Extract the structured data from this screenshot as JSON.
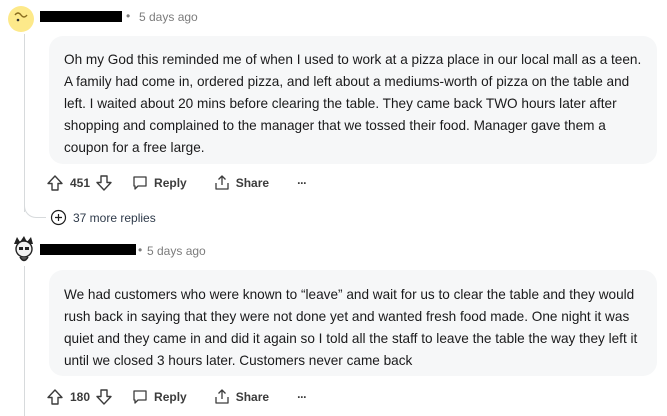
{
  "comments": [
    {
      "time": "5 days ago",
      "body": "Oh my God this reminded me of when I used to work at a pizza place in our local mall as a teen. A family had come in, ordered pizza, and left about a mediums-worth of pizza on the table and left. I waited about 20 mins before clearing the table. They came back TWO hours later after shopping and complained to the manager that we tossed their food. Manager gave them a coupon for a free large.",
      "votes": "451",
      "reply_label": "Reply",
      "share_label": "Share",
      "more_label": "···"
    },
    {
      "time": "5 days ago",
      "body": "We had customers who were known to “leave” and wait for us to clear the table and they would rush back in saying that they were not done yet and wanted fresh food made. One night it was quiet and they came in and did it again so I told all the staff to leave the table the way they left it until we closed 3 hours later. Customers never came back",
      "votes": "180",
      "reply_label": "Reply",
      "share_label": "Share",
      "more_label": "···"
    }
  ],
  "more_replies": "37 more replies",
  "meta_separator": "•",
  "icons": {
    "upvote": "upvote-icon",
    "downvote": "downvote-icon",
    "reply": "comment-bubble-icon",
    "share": "share-icon",
    "expand": "plus-circle-icon"
  }
}
